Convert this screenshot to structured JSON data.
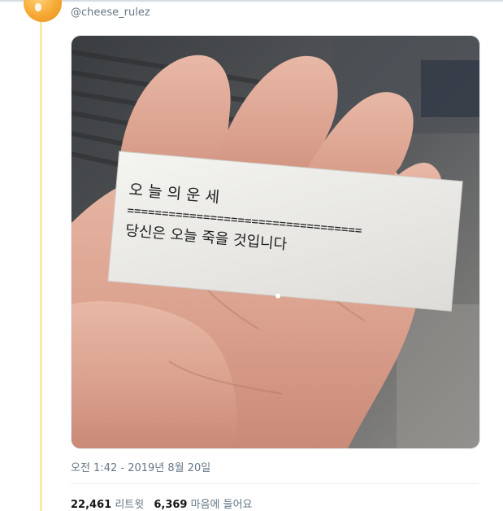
{
  "tweet": {
    "handle": "@cheese_rulez",
    "timestamp": "오전 1:42 - 2019년 8월 20일",
    "retweets_count": "22,461",
    "retweets_label": "리트윗",
    "likes_count": "6,369",
    "likes_label": "마음에 들어요"
  },
  "photo": {
    "ticket_title": "오 늘 의 운 세",
    "ticket_rule": "==================================",
    "ticket_message": "당신은 오늘 죽을 것입니다"
  },
  "colors": {
    "avatar": "#f6a935",
    "thread_line": "#fbe9a6",
    "muted_text": "#657786"
  }
}
